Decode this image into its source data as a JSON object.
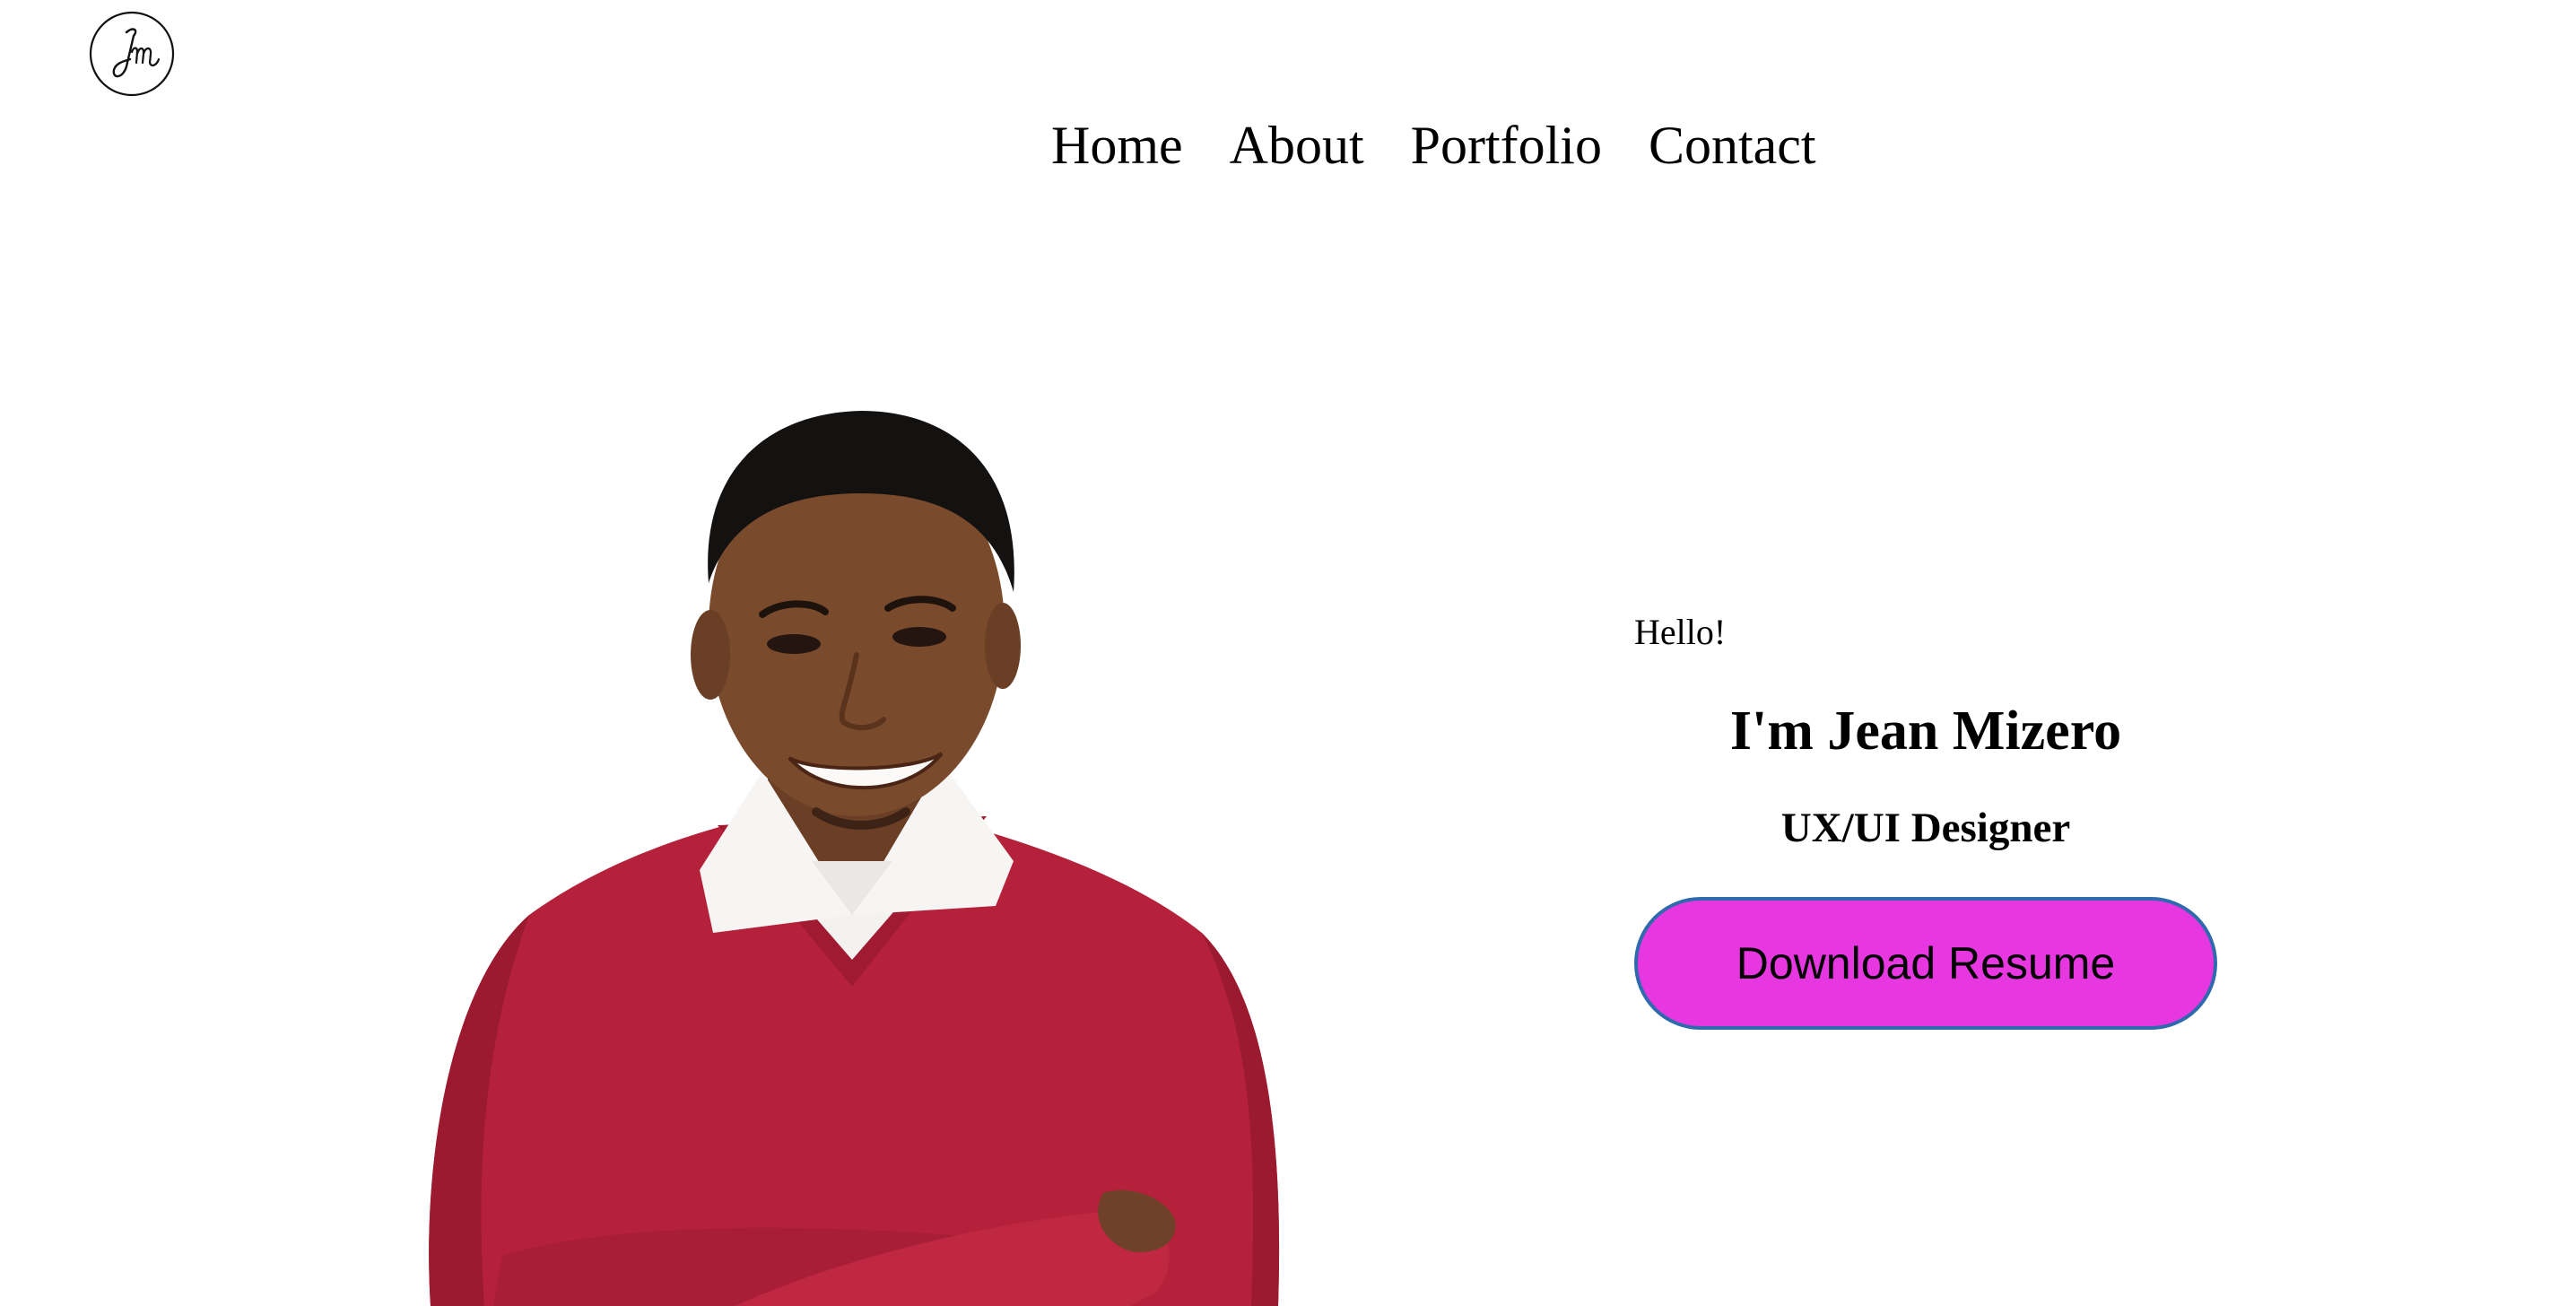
{
  "header": {
    "logo_text": "Jm",
    "logo_icon": "signature-monogram-icon"
  },
  "nav": {
    "items": [
      {
        "label": "Home"
      },
      {
        "label": "About"
      },
      {
        "label": "Portfolio"
      },
      {
        "label": "Contact"
      }
    ]
  },
  "hero": {
    "greeting": "Hello!",
    "name": "I'm Jean Mizero",
    "role": "UX/UI Designer",
    "cta_label": "Download Resume",
    "colors": {
      "cta_background": "#e637e0",
      "cta_border": "#2f6aae",
      "sweater": "#b5213a",
      "shirt": "#f4f2f0",
      "skin": "#7a4a2c",
      "hair": "#141111"
    }
  }
}
